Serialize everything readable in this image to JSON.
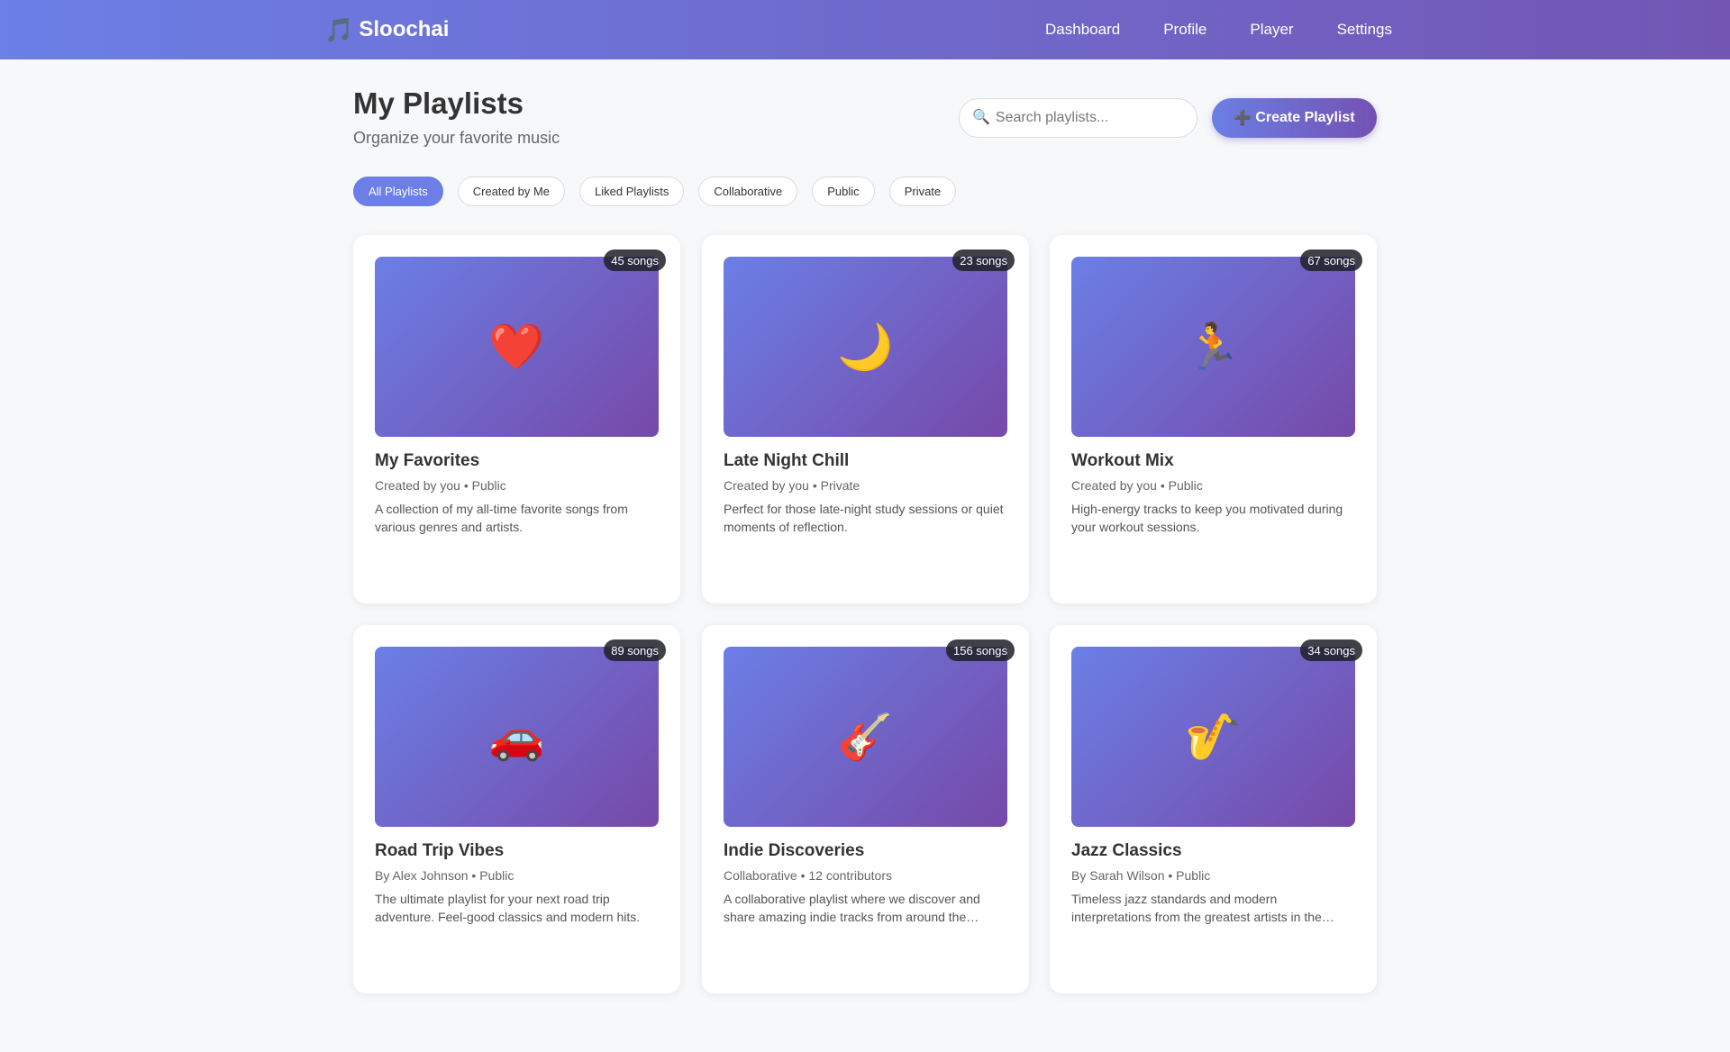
{
  "app": {
    "brand_icon": "🎵",
    "brand_name": "Sloochai",
    "nav": [
      "Dashboard",
      "Profile",
      "Player",
      "Settings"
    ]
  },
  "page": {
    "title": "My Playlists",
    "subtitle": "Organize your favorite music"
  },
  "search": {
    "icon": "🔍",
    "placeholder": "Search playlists...",
    "value": ""
  },
  "create_button": {
    "icon": "➕",
    "label": "Create Playlist"
  },
  "filters": {
    "active_index": 0,
    "items": [
      "All Playlists",
      "Created by Me",
      "Liked Playlists",
      "Collaborative",
      "Public",
      "Private"
    ]
  },
  "playlists": [
    {
      "cover_icon": "❤️",
      "song_count": "45 songs",
      "title": "My Favorites",
      "meta": "Created by you • Public",
      "description": "A collection of my all-time favorite songs from various genres and artists."
    },
    {
      "cover_icon": "🌙",
      "song_count": "23 songs",
      "title": "Late Night Chill",
      "meta": "Created by you • Private",
      "description": "Perfect for those late-night study sessions or quiet moments of reflection."
    },
    {
      "cover_icon": "🏃",
      "song_count": "67 songs",
      "title": "Workout Mix",
      "meta": "Created by you • Public",
      "description": "High-energy tracks to keep you motivated during your workout sessions."
    },
    {
      "cover_icon": "🚗",
      "song_count": "89 songs",
      "title": "Road Trip Vibes",
      "meta": "By Alex Johnson • Public",
      "description": "The ultimate playlist for your next road trip adventure. Feel-good classics and modern hits."
    },
    {
      "cover_icon": "🎸",
      "song_count": "156 songs",
      "title": "Indie Discoveries",
      "meta": "Collaborative • 12 contributors",
      "description": "A collaborative playlist where we discover and share amazing indie tracks from around the…"
    },
    {
      "cover_icon": "🎷",
      "song_count": "34 songs",
      "title": "Jazz Classics",
      "meta": "By Sarah Wilson • Public",
      "description": "Timeless jazz standards and modern interpretations from the greatest artists in the…"
    }
  ],
  "colors": {
    "accent": "#6b7fe6",
    "accent_dark": "#7451b2",
    "background": "#f7f8fa"
  }
}
